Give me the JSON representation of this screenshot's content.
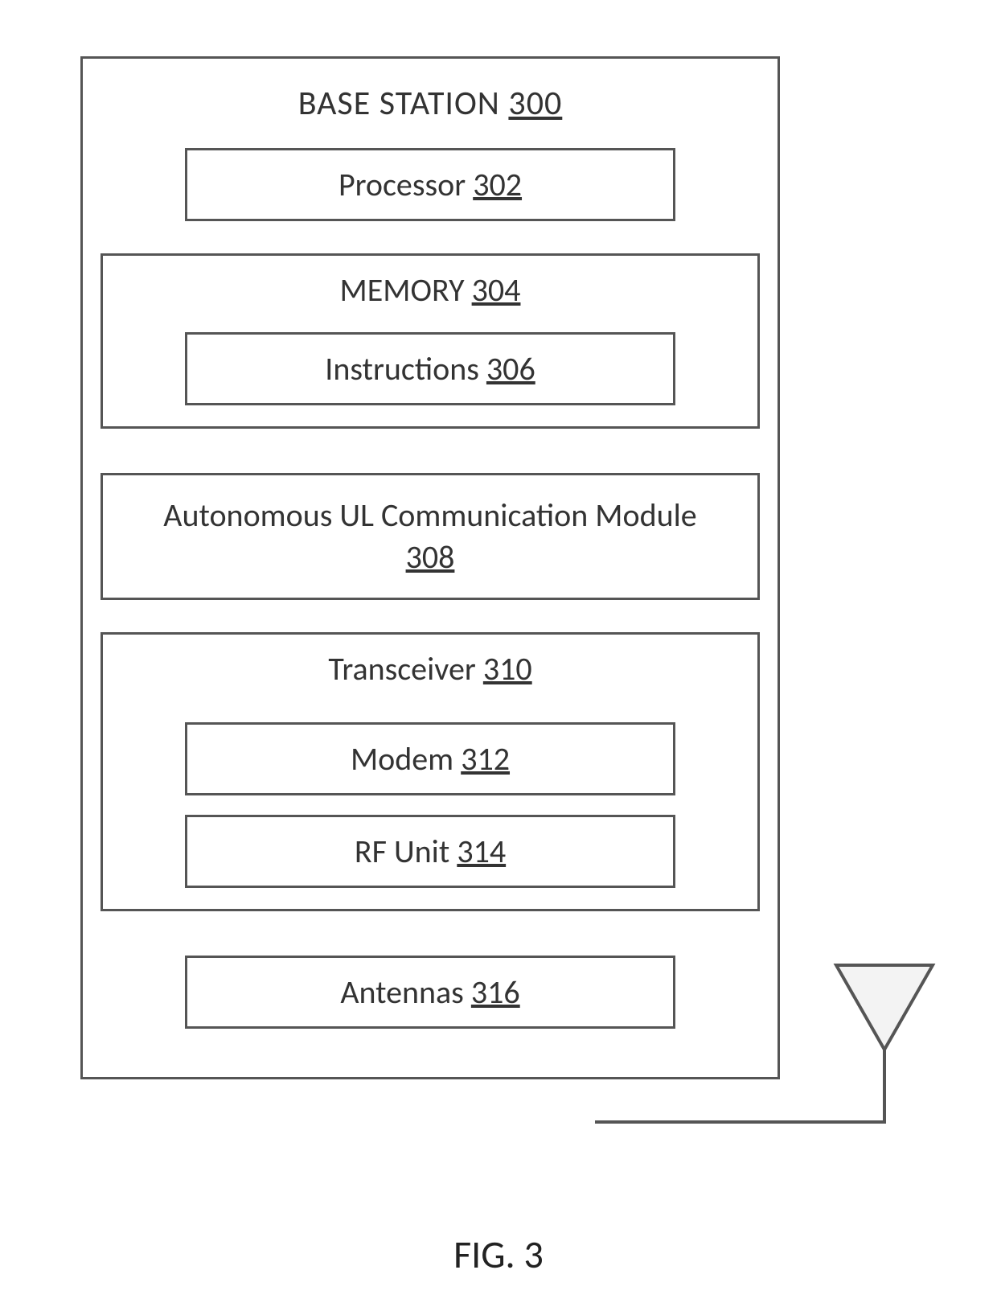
{
  "figure": {
    "caption": "FIG. 3"
  },
  "outer": {
    "label": "BASE STATION",
    "ref": "300"
  },
  "blocks": {
    "processor": {
      "label": "Processor",
      "ref": "302"
    },
    "memory": {
      "label": "MEMORY",
      "ref": "304"
    },
    "instructions": {
      "label": "Instructions",
      "ref": "306"
    },
    "aul": {
      "label": "Autonomous UL Communication Module",
      "ref": "308"
    },
    "transceiver": {
      "label": "Transceiver",
      "ref": "310"
    },
    "modem": {
      "label": "Modem",
      "ref": "312"
    },
    "rf": {
      "label": "RF Unit",
      "ref": "314"
    },
    "antennas": {
      "label": "Antennas",
      "ref": "316"
    }
  },
  "colors": {
    "stroke": "#555555"
  }
}
